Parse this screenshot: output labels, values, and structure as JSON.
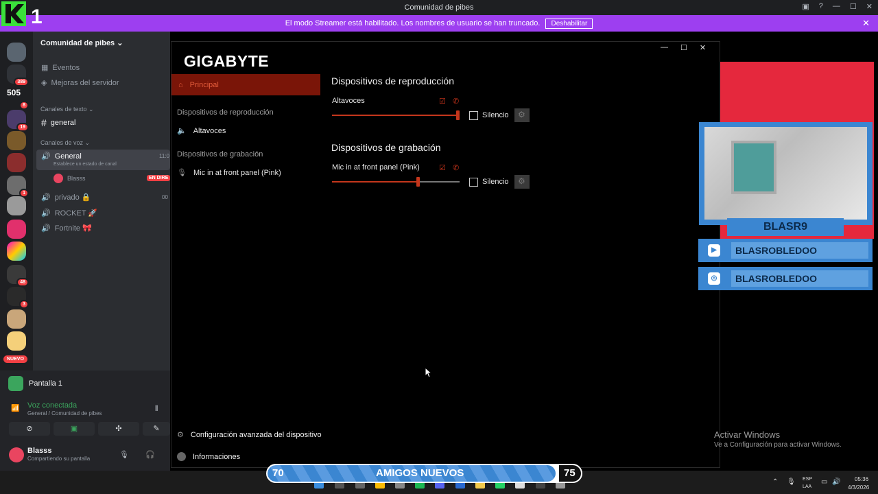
{
  "discord": {
    "window_title": "Comunidad de pibes",
    "streamer_banner": "El modo Streamer está habilitado. Los nombres de usuario se han truncado.",
    "streamer_disable": "Deshabilitar",
    "server_name": "Comunidad de pibes",
    "menu": [
      "Eventos",
      "Mejoras del servidor"
    ],
    "cat_text": "Canales de texto",
    "text_channel": "general",
    "cat_voice": "Canales de voz",
    "voice_general": "General",
    "voice_general_sub": "Establece un estado de canal",
    "voice_general_time": "11:0",
    "voice_user": "Blasss",
    "voice_user_badge": "EN DIRE",
    "voice_channels": [
      "privado 🔒",
      "ROCKET 🚀",
      "Fortnite 🎀"
    ],
    "voice_privado_count": "00",
    "rail_badges": [
      "389",
      "8",
      "19",
      "1",
      "48",
      "3"
    ],
    "rail_505": "505",
    "nuevo": "NUEVO",
    "pantalla": "Pantalla 1",
    "voz_conectada": "Voz conectada",
    "voz_sub": "General / Comunidad de pibes",
    "user_name": "Blasss",
    "user_status": "Compartiendo su pantalla"
  },
  "gigabyte": {
    "logo": "GIGABYTE",
    "nav_principal": "Principal",
    "side_head_repro": "Dispositivos de reproducción",
    "side_altavoces": "Altavoces",
    "side_head_grab": "Dispositivos de grabación",
    "side_mic": "Mic in at front panel (Pink)",
    "sec_repro": "Dispositivos de reproducción",
    "dev_altavoces": "Altavoces",
    "altavoces_level": 1.0,
    "sec_grab": "Dispositivos de grabación",
    "dev_mic": "Mic in at front panel (Pink)",
    "mic_level": 0.68,
    "silencio": "Silencio",
    "footer_config": "Configuración avanzada del dispositivo",
    "footer_info": "Informaciones"
  },
  "overlay": {
    "cam_name": "BLASR9",
    "youtube": "BLASROBLEDOO",
    "instagram": "BLASROBLEDOO",
    "logo_text": "1",
    "goal_current": "70",
    "goal_label": "AMIGOS NUEVOS",
    "goal_target": "75",
    "goal_progress": 0.92
  },
  "windows": {
    "activate_title": "Activar Windows",
    "activate_sub": "Ve a Configuración para activar Windows.",
    "lang1": "ESP",
    "lang2": "LAA",
    "time": "05:36",
    "date": "4/3/2026"
  },
  "colors": {
    "discord_purple": "#9d3ff0",
    "giga_red": "#c4361c",
    "overlay_red": "#e5283d",
    "overlay_blue": "#3b86d1"
  }
}
